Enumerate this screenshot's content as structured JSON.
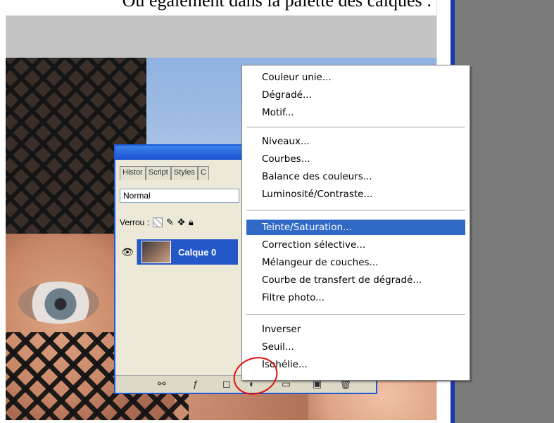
{
  "caption": "Ou également dans la palette des calques :",
  "palette": {
    "tabs": [
      "Histor",
      "Script",
      "Styles",
      "C"
    ],
    "blend_mode": "Normal",
    "lock_label": "Verrou :",
    "layer_name": "Calque 0"
  },
  "menu": {
    "groups": [
      [
        "Couleur unie...",
        "Dégradé...",
        "Motif..."
      ],
      [
        "Niveaux...",
        "Courbes...",
        "Balance des couleurs...",
        "Luminosité/Contraste..."
      ],
      [
        "Teinte/Saturation...",
        "Correction sélective...",
        "Mélangeur de couches...",
        "Courbe de transfert de dégradé...",
        "Filtre photo..."
      ],
      [
        "Inverser",
        "Seuil...",
        "Isohélie..."
      ]
    ],
    "selected": "Teinte/Saturation..."
  },
  "colors": {
    "selection": "#3169c6",
    "highlight_circle": "#e01010",
    "window_blue": "#1c5ad8"
  }
}
